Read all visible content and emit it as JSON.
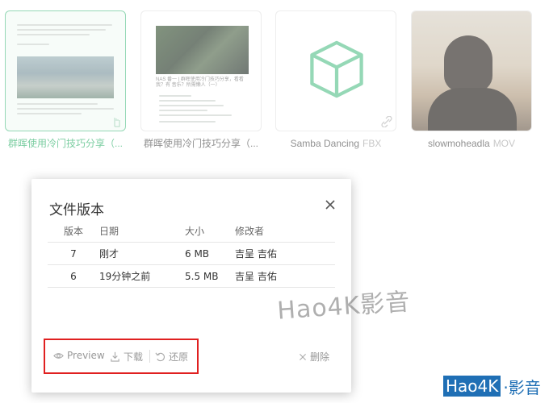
{
  "files": [
    {
      "name": "群晖使用冷门技巧分享（...",
      "ext": "",
      "type": "doc",
      "selected": true
    },
    {
      "name": "群晖使用冷门技巧分享（...",
      "ext": "",
      "type": "doc",
      "selected": false
    },
    {
      "name": "Samba Dancing",
      "ext": "FBX",
      "type": "model",
      "selected": false
    },
    {
      "name": "slowmoheadla",
      "ext": "MOV",
      "type": "video",
      "selected": false
    }
  ],
  "doc2_snippet": "NAS 番一 | 群晖使用冷门技巧分享，看看我？有 音乐？所需懒人（一）",
  "modal": {
    "title": "文件版本",
    "columns": [
      "版本",
      "日期",
      "大小",
      "修改者"
    ],
    "rows": [
      {
        "version": "7",
        "date": "刚才",
        "size": "6 MB",
        "modifier": "吉呈 吉佑"
      },
      {
        "version": "6",
        "date": "19分钟之前",
        "size": "5.5 MB",
        "modifier": "吉呈 吉佑"
      }
    ],
    "actions": {
      "preview": "Preview",
      "download": "下载",
      "restore": "还原",
      "delete": "删除"
    }
  },
  "watermark": {
    "big": "Hao4K影音",
    "badge_a": "Hao4K",
    "badge_b": "·影音"
  },
  "colors": {
    "accent": "#35b36f",
    "highlight_box": "#e02020",
    "model_icon": "#5cc38f"
  }
}
